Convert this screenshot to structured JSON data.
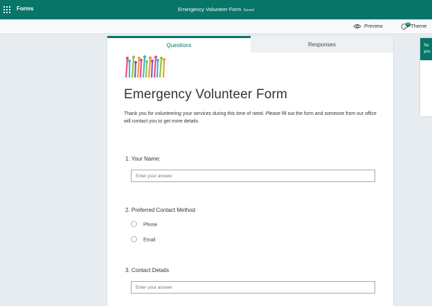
{
  "app": {
    "name": "Forms",
    "document_title": "Emergency Volunteer Form",
    "save_status": "Saved"
  },
  "toolbar": {
    "preview_label": "Preview",
    "theme_label": "Theme",
    "theme_badge": "8"
  },
  "tabs": [
    {
      "label": "Questions",
      "active": true
    },
    {
      "label": "Responses",
      "active": false
    }
  ],
  "form": {
    "banner_icon": "raised-hands-banner",
    "title": "Emergency Volunteer Form",
    "description": "Thank you for volunteering your services during this time of need. Please fill out the form and someone from our office will contact you to get more details.",
    "questions": [
      {
        "label": "1. Your Name:",
        "placeholder": "Enter your answer"
      },
      {
        "label": "2. Preferred Contact Method",
        "options": [
          "Phone",
          "Email"
        ]
      },
      {
        "label": "3. Contact Details",
        "placeholder": "Enter your answer"
      }
    ]
  },
  "side_panel": {
    "header_text": "Se\nyou"
  },
  "colors": {
    "brand": "#077568",
    "background": "#e6ecef"
  }
}
